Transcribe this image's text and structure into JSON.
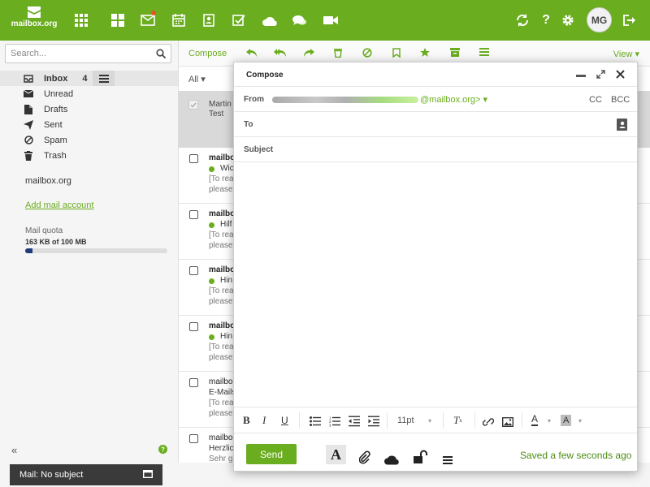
{
  "app": {
    "logo_text": "mailbox.org",
    "user_initials": "MG"
  },
  "topbar": {
    "icons": [
      "apps-grid-icon",
      "portal-icon",
      "mail-icon",
      "calendar-icon",
      "address-book-icon",
      "tasks-icon",
      "drive-cloud-icon",
      "chat-icon",
      "video-icon",
      "refresh-icon",
      "help-icon",
      "settings-icon",
      "logout-icon"
    ],
    "mail_has_notification": true
  },
  "sidebar": {
    "search_placeholder": "Search...",
    "folders": [
      {
        "label": "Inbox",
        "count": "4",
        "icon": "inbox-icon"
      },
      {
        "label": "Unread",
        "icon": "envelope-icon"
      },
      {
        "label": "Drafts",
        "icon": "document-icon"
      },
      {
        "label": "Sent",
        "icon": "paper-plane-icon"
      },
      {
        "label": "Spam",
        "icon": "block-icon"
      },
      {
        "label": "Trash",
        "icon": "trash-icon"
      }
    ],
    "account": "mailbox.org",
    "add_account": "Add mail account",
    "quota_label": "Mail quota",
    "quota_value": "163 KB of 100 MB",
    "quota_fraction": 0.05
  },
  "mail_toolbar": {
    "compose": "Compose",
    "view": "View",
    "icons": [
      "reply-icon",
      "reply-all-icon",
      "forward-icon",
      "delete-icon",
      "spam-icon",
      "bookmark-icon",
      "star-icon",
      "archive-icon",
      "more-menu-icon"
    ]
  },
  "mail_list": {
    "filter": "All",
    "selected": {
      "name_line1": "Martin",
      "name_line2": "Test"
    },
    "rows": [
      {
        "from": "mailbo",
        "subject": "Wic",
        "p1": "[To rea",
        "p2": "please",
        "unread": true
      },
      {
        "from": "mailbo",
        "subject": "Hilf",
        "p1": "[To rea",
        "p2": "please",
        "unread": true
      },
      {
        "from": "mailbo",
        "subject": "Hin",
        "p1": "[To rea",
        "p2": "please",
        "unread": true
      },
      {
        "from": "mailbo",
        "subject": "Hin",
        "p1": "[To rea",
        "p2": "please",
        "unread": true
      },
      {
        "from": "mailbo",
        "subject": "E-Mails",
        "p1": "[To rea",
        "p2": "please",
        "unread": false
      },
      {
        "from": "mailbo",
        "subject": "Herzlic",
        "p1": "Sehr g",
        "p2": "",
        "unread": false
      }
    ]
  },
  "taskbar": {
    "label": "Mail: No subject"
  },
  "compose": {
    "title": "Compose",
    "from_label": "From",
    "from_address": "@mailbox.org>",
    "cc": "CC",
    "bcc": "BCC",
    "to_label": "To",
    "subject_label": "Subject",
    "font_size": "11pt",
    "send": "Send",
    "status": "Saved a few seconds ago",
    "format_icons": [
      "bold-icon",
      "italic-icon",
      "underline-icon",
      "bullet-list-icon",
      "numbered-list-icon",
      "outdent-icon",
      "indent-icon",
      "clear-format-icon",
      "link-icon",
      "image-icon",
      "text-color-icon",
      "highlight-color-icon"
    ],
    "footer_icons": [
      "text-format-icon",
      "attachment-icon",
      "cloud-attach-icon",
      "security-lock-icon",
      "options-menu-icon"
    ]
  },
  "colors": {
    "accent": "#6aad1e",
    "quota": "#1f3c7a",
    "notification": "#e8541e"
  }
}
